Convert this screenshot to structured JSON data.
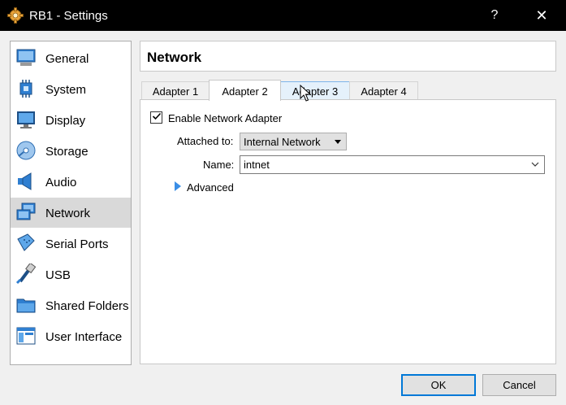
{
  "window": {
    "title": "RB1 - Settings",
    "help_symbol": "?",
    "close_symbol": "✕",
    "icon": "gear-icon"
  },
  "sidebar": {
    "items": [
      {
        "label": "General",
        "icon": "general-icon"
      },
      {
        "label": "System",
        "icon": "system-icon"
      },
      {
        "label": "Display",
        "icon": "display-icon"
      },
      {
        "label": "Storage",
        "icon": "storage-icon"
      },
      {
        "label": "Audio",
        "icon": "audio-icon"
      },
      {
        "label": "Network",
        "icon": "network-icon",
        "selected": true
      },
      {
        "label": "Serial Ports",
        "icon": "serial-ports-icon"
      },
      {
        "label": "USB",
        "icon": "usb-icon"
      },
      {
        "label": "Shared Folders",
        "icon": "shared-folders-icon"
      },
      {
        "label": "User Interface",
        "icon": "user-interface-icon"
      }
    ]
  },
  "page": {
    "title": "Network"
  },
  "tabs": [
    {
      "label": "Adapter 1"
    },
    {
      "label": "Adapter 2",
      "active": true
    },
    {
      "label": "Adapter 3",
      "hover": true
    },
    {
      "label": "Adapter 4"
    }
  ],
  "adapter": {
    "enable_label": "Enable Network Adapter",
    "enabled": true,
    "attached_label": "Attached to:",
    "attached_value": "Internal Network",
    "name_label": "Name:",
    "name_value": "intnet",
    "advanced_label": "Advanced"
  },
  "buttons": {
    "ok": "OK",
    "cancel": "Cancel"
  },
  "colors": {
    "accent": "#0078d7",
    "selection": "#d9d9d9",
    "expander": "#3a8ee6"
  }
}
